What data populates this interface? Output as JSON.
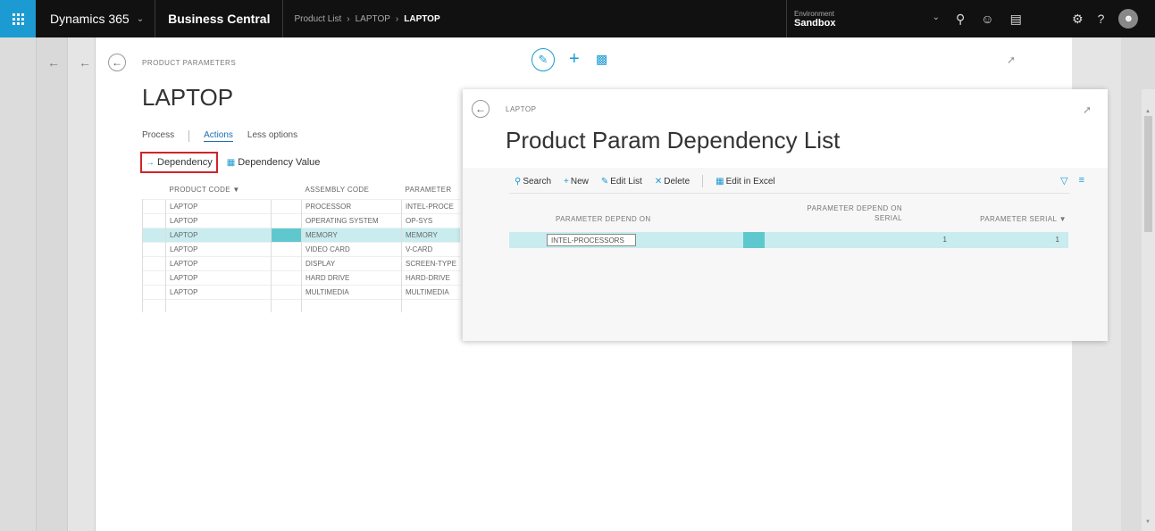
{
  "topbar": {
    "brand": "Dynamics 365",
    "app": "Business Central",
    "breadcrumbs": [
      "Product List",
      "LAPTOP",
      "LAPTOP"
    ],
    "environment_label": "Environment",
    "environment_value": "Sandbox",
    "accent": "#1b9bd1"
  },
  "main": {
    "caption": "PRODUCT PARAMETERS",
    "title": "LAPTOP",
    "menu": [
      "Process",
      "Actions",
      "Less options"
    ],
    "actions": [
      "Dependency",
      "Dependency Value"
    ],
    "columns": [
      "PRODUCT CODE ▼",
      "ASSEMBLY CODE",
      "PARAMETER"
    ],
    "rows": [
      {
        "product": "LAPTOP",
        "assembly": "PROCESSOR",
        "parameter": "INTEL-PROCE"
      },
      {
        "product": "LAPTOP",
        "assembly": "OPERATING SYSTEM",
        "parameter": "OP-SYS"
      },
      {
        "product": "LAPTOP",
        "assembly": "MEMORY",
        "parameter": "MEMORY"
      },
      {
        "product": "LAPTOP",
        "assembly": "VIDEO CARD",
        "parameter": "V-CARD"
      },
      {
        "product": "LAPTOP",
        "assembly": "DISPLAY",
        "parameter": "SCREEN-TYPE"
      },
      {
        "product": "LAPTOP",
        "assembly": "HARD DRIVE",
        "parameter": "HARD-DRIVE"
      },
      {
        "product": "LAPTOP",
        "assembly": "MULTIMEDIA",
        "parameter": "MULTIMEDIA"
      },
      {
        "product": "",
        "assembly": "",
        "parameter": ""
      }
    ],
    "selected_row": 2
  },
  "panel": {
    "caption": "LAPTOP",
    "title": "Product Param Dependency List",
    "toolbar": [
      "Search",
      "New",
      "Edit List",
      "Delete",
      "Edit in Excel"
    ],
    "columns": {
      "depend_on": "PARAMETER DEPEND ON",
      "depend_on_serial_1": "PARAMETER DEPEND ON",
      "depend_on_serial_2": "SERIAL",
      "serial": "PARAMETER SERIAL ▼"
    },
    "row": {
      "depend_on": "INTEL-PROCESSORS",
      "depend_on_serial": "1",
      "serial": "1"
    }
  }
}
